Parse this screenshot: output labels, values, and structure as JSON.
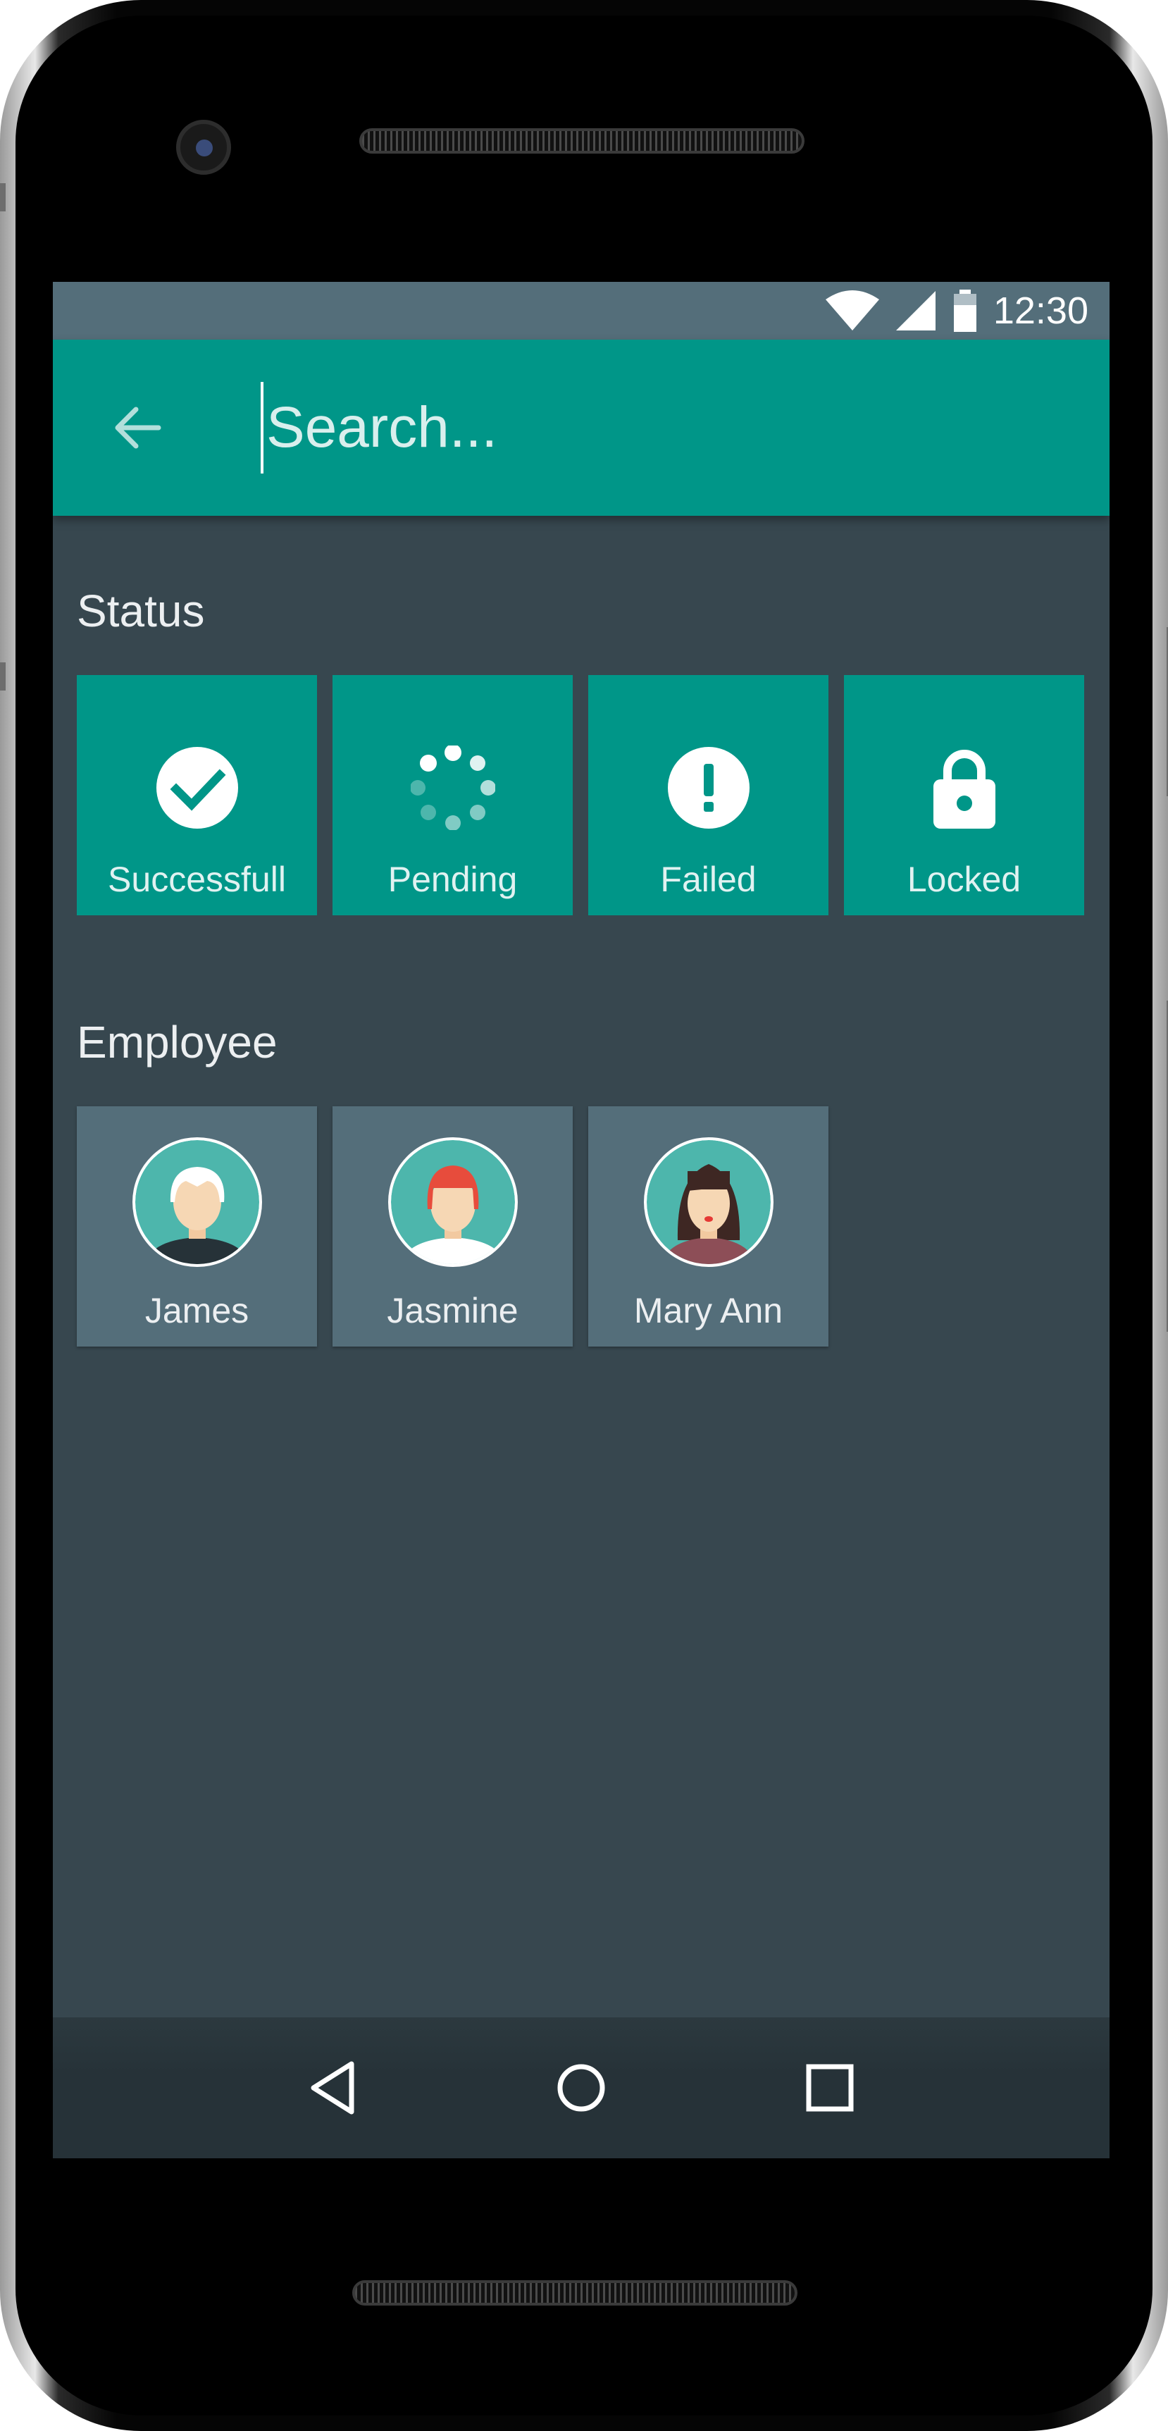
{
  "status_bar": {
    "time": "12:30",
    "icons": [
      "wifi-icon",
      "signal-icon",
      "battery-icon"
    ]
  },
  "app_bar": {
    "back_icon": "arrow-back-icon",
    "search": {
      "placeholder": "Search...",
      "value": ""
    }
  },
  "status_section": {
    "title": "Status",
    "items": [
      {
        "label": "Successfull",
        "icon": "check-circle-icon"
      },
      {
        "label": "Pending",
        "icon": "spinner-icon"
      },
      {
        "label": "Failed",
        "icon": "alert-circle-icon"
      },
      {
        "label": "Locked",
        "icon": "lock-icon"
      }
    ]
  },
  "employee_section": {
    "title": "Employee",
    "items": [
      {
        "name": "James",
        "icon": "avatar-white-hair-icon"
      },
      {
        "name": "Jasmine",
        "icon": "avatar-red-hair-icon"
      },
      {
        "name": "Mary Ann",
        "icon": "avatar-dark-hair-icon"
      }
    ]
  },
  "nav_bar": {
    "icons": [
      "back-triangle-icon",
      "home-circle-icon",
      "recents-square-icon"
    ]
  },
  "colors": {
    "primary": "#009688",
    "status_bar": "#546e7a",
    "background": "#37474f",
    "tile_employee": "#546e7a",
    "nav_bar": "#263238"
  }
}
